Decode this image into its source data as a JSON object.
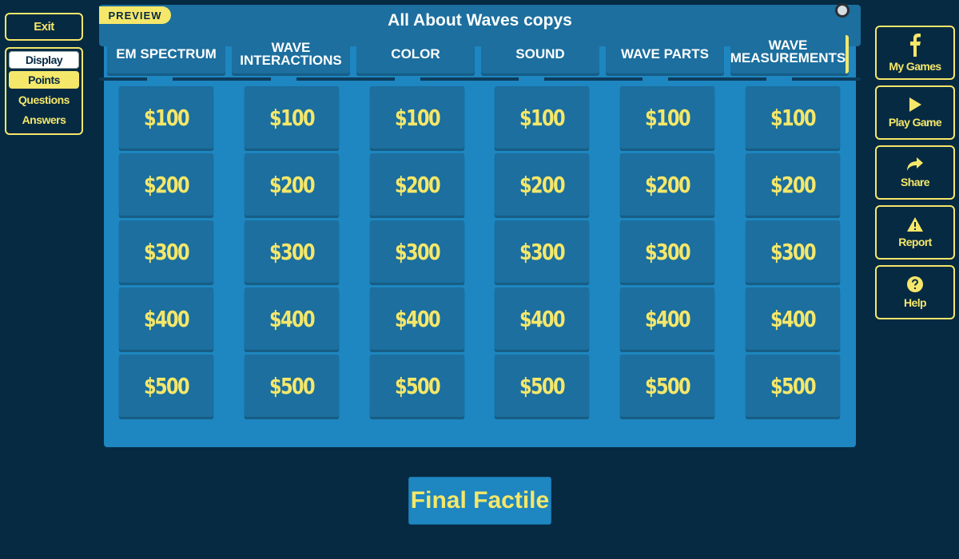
{
  "left": {
    "exit_label": "Exit",
    "view_options": [
      "Display",
      "Points",
      "Questions",
      "Answers"
    ]
  },
  "board": {
    "preview_label": "PREVIEW",
    "title": "All About Waves copys",
    "categories": [
      "EM SPECTRUM",
      "WAVE INTERACTIONS",
      "COLOR",
      "SOUND",
      "WAVE PARTS",
      "WAVE MEASUREMENTS"
    ],
    "values": [
      "$100",
      "$200",
      "$300",
      "$400",
      "$500"
    ]
  },
  "final_label": "Final Factile",
  "right": {
    "my_games": "My Games",
    "play_game": "Play Game",
    "share": "Share",
    "report": "Report",
    "help": "Help"
  },
  "colors": {
    "accent": "#f5e76a",
    "board": "#1e86c0",
    "tile": "#1c6f9e",
    "background": "#062a42"
  },
  "icons": [
    "facebook-icon",
    "play-icon",
    "share-icon",
    "warning-icon",
    "help-icon",
    "gear-icon"
  ]
}
